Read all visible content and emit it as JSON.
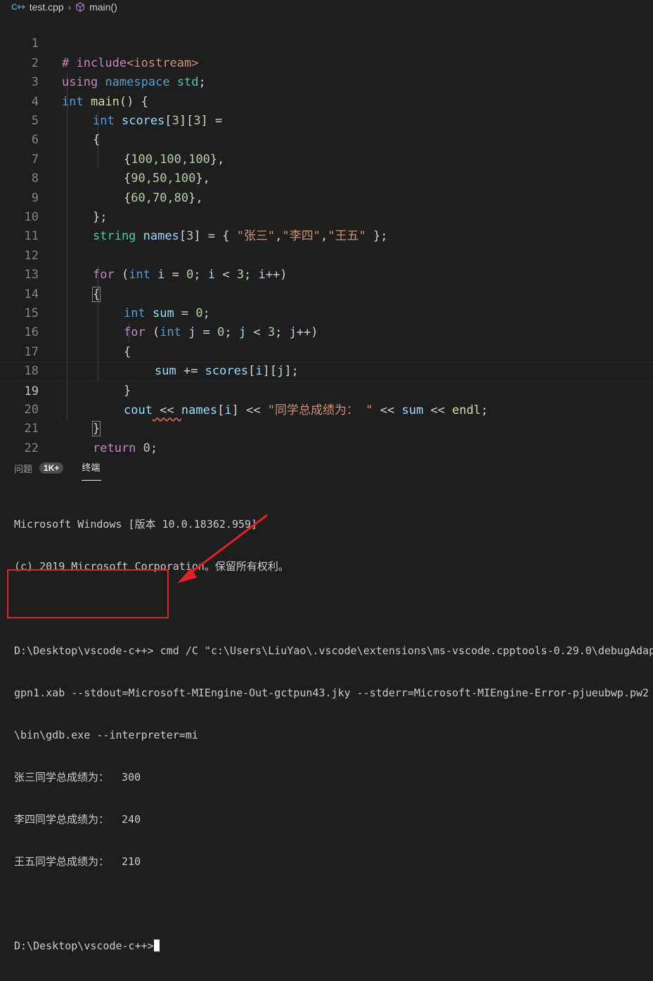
{
  "breadcrumb": {
    "lang_icon": "C++",
    "file": "test.cpp",
    "symbol": "main()"
  },
  "editor": {
    "lines": [
      {
        "n": "1"
      },
      {
        "n": "2"
      },
      {
        "n": "3"
      },
      {
        "n": "4"
      },
      {
        "n": "5"
      },
      {
        "n": "6"
      },
      {
        "n": "7"
      },
      {
        "n": "8"
      },
      {
        "n": "9"
      },
      {
        "n": "10"
      },
      {
        "n": "11"
      },
      {
        "n": "12"
      },
      {
        "n": "13"
      },
      {
        "n": "14"
      },
      {
        "n": "15"
      },
      {
        "n": "16"
      },
      {
        "n": "17"
      },
      {
        "n": "18"
      },
      {
        "n": "19"
      },
      {
        "n": "20"
      },
      {
        "n": "21"
      },
      {
        "n": "22"
      }
    ],
    "code": {
      "l1_hash": "# ",
      "l1_include": "include",
      "l1_header": "<iostream>",
      "l2_using": "using",
      "l2_namespace": "namespace",
      "l2_std": "std",
      "l2_semi": ";",
      "l3_int": "int",
      "l3_main": "main",
      "l3_rest": "() {",
      "l4_int": "int",
      "l4_scores": "scores",
      "l4_b1": "[",
      "l4_3a": "3",
      "l4_b2": "][",
      "l4_3b": "3",
      "l4_b3": "] =",
      "l5": "{",
      "l6_open": "{",
      "l6_v": "100,100,100",
      "l6_close": "},",
      "l7_open": "{",
      "l7_v": "90,50,100",
      "l7_close": "},",
      "l8_open": "{",
      "l8_v": "60,70,80",
      "l8_close": "},",
      "l9": "};",
      "l10_string": "string",
      "l10_names": "names",
      "l10_b1": "[",
      "l10_3": "3",
      "l10_b2": "] = { ",
      "l10_s1": "\"张三\"",
      "l10_c1": ",",
      "l10_s2": "\"李四\"",
      "l10_c2": ",",
      "l10_s3": "\"王五\"",
      "l10_end": " };",
      "l12_for": "for",
      "l12_p1": " (",
      "l12_int": "int",
      "l12_i1": "i",
      "l12_eq": " = ",
      "l12_0": "0",
      "l12_semi1": "; ",
      "l12_i2": "i",
      "l12_lt": " < ",
      "l12_3": "3",
      "l12_semi2": "; ",
      "l12_i3": "i",
      "l12_inc": "++)",
      "l13": "{",
      "l14_int": "int",
      "l14_sum": "sum",
      "l14_eq": " = ",
      "l14_0": "0",
      "l14_semi": ";",
      "l15_for": "for",
      "l15_p1": " (",
      "l15_int": "int",
      "l15_j1": "j",
      "l15_eq": " = ",
      "l15_0": "0",
      "l15_semi1": "; ",
      "l15_j2": "j",
      "l15_lt": " < ",
      "l15_3": "3",
      "l15_semi2": "; ",
      "l15_j3": "j",
      "l15_inc": "++)",
      "l16": "{",
      "l17_sum": "sum",
      "l17_op": " += ",
      "l17_scores": "scores",
      "l17_b1": "[",
      "l17_i": "i",
      "l17_b2": "][",
      "l17_j": "j",
      "l17_b3": "];",
      "l18": "}",
      "l19_cout": "cout",
      "l19_op1": " << ",
      "l19_names": "names",
      "l19_b1": "[",
      "l19_i": "i",
      "l19_b2": "]",
      "l19_op2": " << ",
      "l19_str": "\"同学总成绩为： \"",
      "l19_op3": " << ",
      "l19_sum": "sum",
      "l19_op4": " << ",
      "l19_endl": "endl",
      "l19_semi": ";",
      "l20": "}",
      "l21_return": "return",
      "l21_sp": " ",
      "l21_0": "0",
      "l21_semi": ";",
      "l22": "}"
    }
  },
  "panel": {
    "tab_problems": "问题",
    "problems_badge": "1K+",
    "tab_terminal": "终端",
    "terminal_lines": [
      "Microsoft Windows [版本 10.0.18362.959]",
      "(c) 2019 Microsoft Corporation。保留所有权利。",
      "",
      "D:\\Desktop\\vscode-c++> cmd /C \"c:\\Users\\LiuYao\\.vscode\\extensions\\ms-vscode.cpptools-0.29.0\\debugAdap",
      "gpn1.xab --stdout=Microsoft-MIEngine-Out-gctpun43.jky --stderr=Microsoft-MIEngine-Error-pjueubwp.pw2",
      "\\bin\\gdb.exe --interpreter=mi",
      "张三同学总成绩为：  300",
      "李四同学总成绩为：  240",
      "王五同学总成绩为：  210",
      "",
      "D:\\Desktop\\vscode-c++>"
    ]
  },
  "colors": {
    "highlight_box": "#d62b2b",
    "arrow": "#e0202a"
  }
}
